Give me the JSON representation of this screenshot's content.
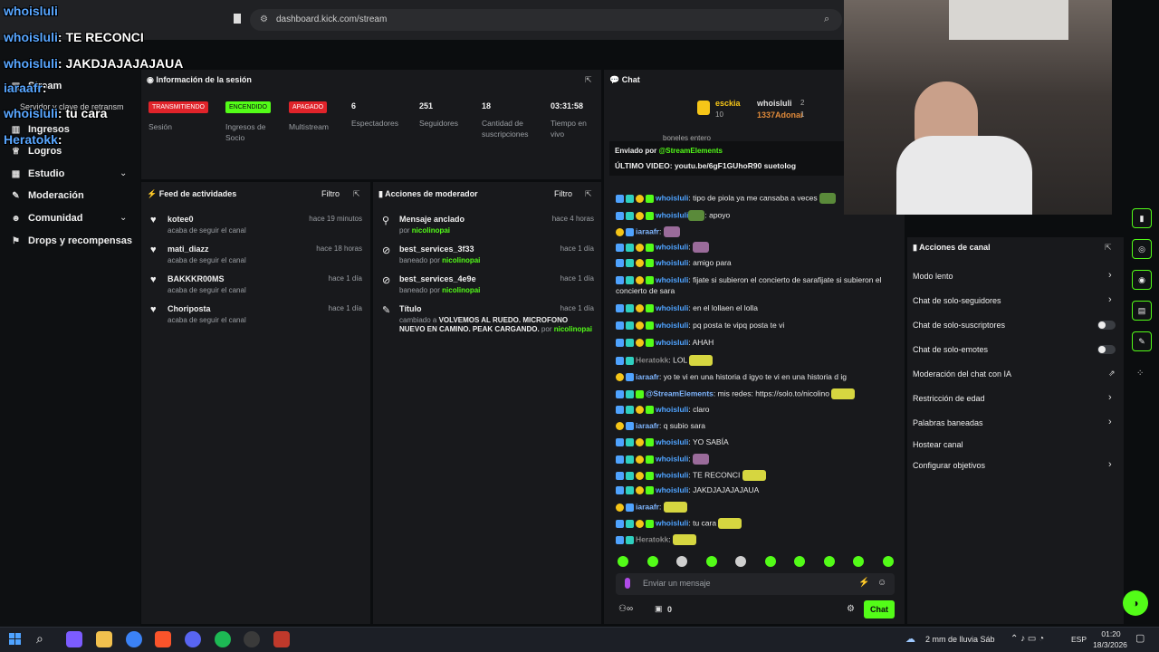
{
  "browser": {
    "url": "dashboard.kick.com/stream"
  },
  "sidebar": {
    "items": [
      {
        "label": "Stream"
      },
      {
        "label": "Ingresos"
      },
      {
        "label": "Logros"
      },
      {
        "label": "Estudio"
      },
      {
        "label": "Moderación"
      },
      {
        "label": "Comunidad"
      },
      {
        "label": "Drops y recompensas"
      }
    ],
    "submenu_label": "Servidor y clave de retransm"
  },
  "session": {
    "title": "Información de la sesión",
    "stats": [
      {
        "badge": "TRANSMITIENDO",
        "badge_color": "#e0232a",
        "label": "Sesión"
      },
      {
        "badge": "ENCENDIDO",
        "badge_color": "#53fc18",
        "label": "Ingresos de Socio"
      },
      {
        "badge": "APAGADO",
        "badge_color": "#e0232a",
        "label": "Multistream"
      },
      {
        "value": "6",
        "label": "Espectadores"
      },
      {
        "value": "251",
        "label": "Seguidores"
      },
      {
        "value": "18",
        "label": "Cantidad de suscripciones"
      },
      {
        "value": "03:31:58",
        "label": "Tiempo en vivo"
      }
    ]
  },
  "feed": {
    "title": "Feed de actividades",
    "filter": "Filtro",
    "items": [
      {
        "name": "kotee0",
        "sub": "acaba de seguir el canal",
        "time": "hace 19 minutos"
      },
      {
        "name": "mati_diazz",
        "sub": "acaba de seguir el canal",
        "time": "hace 18 horas"
      },
      {
        "name": "BAKKKR00MS",
        "sub": "acaba de seguir el canal",
        "time": "hace 1 día"
      },
      {
        "name": "Choriposta",
        "sub": "acaba de seguir el canal",
        "time": "hace 1 día"
      }
    ]
  },
  "modactions": {
    "title": "Acciones de moderador",
    "filter": "Filtro",
    "items": [
      {
        "name": "Mensaje anclado",
        "sub": "por",
        "by": "nicolinopai",
        "time": "hace 4 horas"
      },
      {
        "name": "best_services_3f33",
        "sub": "baneado por",
        "by": "nicolinopai",
        "time": "hace 1 día"
      },
      {
        "name": "best_services_4e9e",
        "sub": "baneado por",
        "by": "nicolinopai",
        "time": "hace 1 día"
      },
      {
        "name": "Título",
        "sub": "cambiado a",
        "detail": "VOLVEMOS AL RUEDO. MICROFONO NUEVO EN CAMINO. PEAK CARGANDO.",
        "by_prefix": "por",
        "by": "nicolinopai",
        "time": "hace 1 día"
      }
    ]
  },
  "chat": {
    "title": "Chat",
    "top_users": [
      {
        "name": "esckia",
        "count": "10"
      },
      {
        "name": "whoisluli",
        "count": "2"
      },
      {
        "name": "1337Adonai",
        "count": "1"
      }
    ],
    "scrolled_text": "boneles entero",
    "pinned_by_label": "Enviado por",
    "pinned_by": "@StreamElements",
    "pinned_text": "ÚLTIMO VIDEO: youtu.be/6gF1GUhoR90 suetolog",
    "messages": [
      {
        "user": "whoisluli",
        "text": ": tipo de piola ya me cansaba a veces"
      },
      {
        "user": "whoisluli",
        "text": ": apoyo"
      },
      {
        "user": "iaraafr",
        "text": ":"
      },
      {
        "user": "whoisluli",
        "text": ":"
      },
      {
        "user": "whoisluli",
        "text": ": amigo para"
      },
      {
        "user": "whoisluli",
        "text": ": fijate si subieron el concierto de sarafijate si subieron el"
      },
      {
        "user": "",
        "text": "concierto de sara"
      },
      {
        "user": "whoisluli",
        "text": ": en el lollaen el lolla"
      },
      {
        "user": "whoisluli",
        "text": ": pq posta te vipq posta te vi"
      },
      {
        "user": "whoisluli",
        "text": ": AHAH"
      },
      {
        "user": "Heratokk",
        "text": ": LOL"
      },
      {
        "user": "iaraafr",
        "text": ": yo te vi en una historia d igyo te vi en una historia d ig"
      },
      {
        "user": "@StreamElements",
        "text": ": mis redes: https://solo.to/nicolino"
      },
      {
        "user": "whoisluli",
        "text": ": claro"
      },
      {
        "user": "iaraafr",
        "text": ": q subio sara"
      },
      {
        "user": "whoisluli",
        "text": ": YO SABÍA"
      },
      {
        "user": "whoisluli",
        "text": ":"
      },
      {
        "user": "whoisluli",
        "text": ": TE RECONCI"
      },
      {
        "user": "whoisluli",
        "text": ": JAKDJAJAJAJAUA"
      },
      {
        "user": "iaraafr",
        "text": ":"
      },
      {
        "user": "whoisluli",
        "text": ": tu cara"
      },
      {
        "user": "Heratokk",
        "text": ":"
      }
    ],
    "input_placeholder": "Enviar un mensaje",
    "count": "0",
    "send_label": "Chat"
  },
  "channel_actions": {
    "title": "Acciones de canal",
    "items": [
      {
        "label": "Modo lento",
        "control": "chevron"
      },
      {
        "label": "Chat de solo-seguidores",
        "control": "chevron"
      },
      {
        "label": "Chat de solo-suscriptores",
        "control": "toggle"
      },
      {
        "label": "Chat de solo-emotes",
        "control": "toggle"
      },
      {
        "label": "Moderación del chat con IA",
        "control": "external"
      },
      {
        "label": "Restricción de edad",
        "control": "chevron"
      },
      {
        "label": "Palabras baneadas",
        "control": "chevron"
      },
      {
        "label": "Hostear canal",
        "control": "none"
      },
      {
        "label": "Configurar objetivos",
        "control": "chevron"
      }
    ]
  },
  "overlay": {
    "lines": [
      {
        "user": "whoisluli",
        "text": ""
      },
      {
        "user": "whoisluli",
        "text": ": TE RECONCI"
      },
      {
        "user": "whoisluli",
        "text": ": JAKDJAJAJAJAUA"
      },
      {
        "user": "iaraafr",
        "text": ":"
      },
      {
        "user": "whoisluli",
        "text": ": tu cara"
      },
      {
        "user": "Heratokk",
        "text": ":"
      }
    ]
  },
  "taskbar": {
    "weather": "2 mm de lluvia Sáb",
    "lang": "ESP",
    "time": "01:20",
    "date": "18/3/2026"
  },
  "colors": {
    "accent": "#53fc18",
    "panel": "#18191c",
    "bg": "#0b0d0f"
  }
}
